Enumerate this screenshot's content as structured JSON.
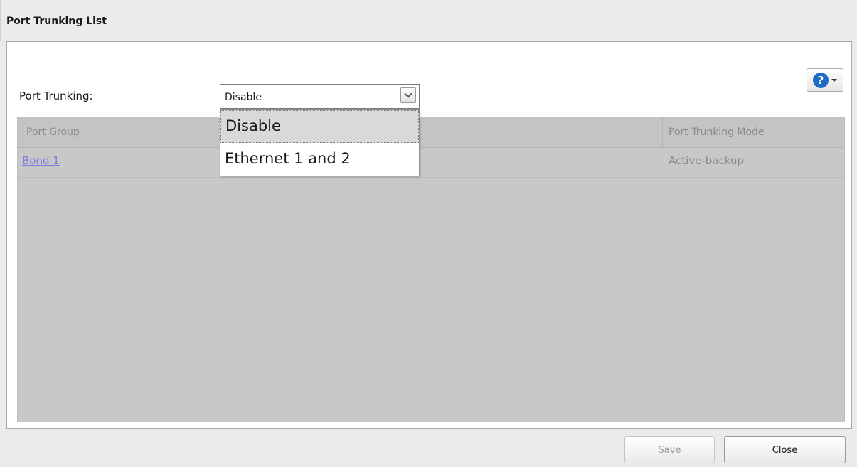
{
  "dialog": {
    "title": "Port Trunking List"
  },
  "help": {
    "icon": "help-icon",
    "glyph": "?"
  },
  "form": {
    "label": "Port Trunking:",
    "select": {
      "value": "Disable",
      "options": [
        "Disable",
        "Ethernet 1 and 2"
      ]
    }
  },
  "table": {
    "columns": [
      "Port Group",
      "Port Trunking Mode"
    ],
    "rows": [
      {
        "group": "Bond 1",
        "mode": "Active-backup"
      }
    ]
  },
  "buttons": {
    "save": "Save",
    "close": "Close"
  },
  "colors": {
    "accent": "#1f6dc2",
    "link": "#7d7de0"
  }
}
